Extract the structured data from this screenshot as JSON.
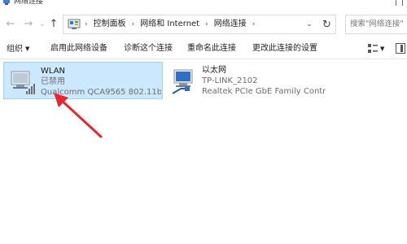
{
  "window": {
    "title": "网络连接"
  },
  "nav": {
    "back_icon": "←",
    "forward_icon": "→",
    "recent_icon": "⌄",
    "up_icon": "↑"
  },
  "address": {
    "crumbs": [
      "控制面板",
      "网络和 Internet",
      "网络连接"
    ],
    "dropdown_icon": "⌄",
    "refresh_icon": "↻"
  },
  "search": {
    "placeholder": "搜索\"网络连接\""
  },
  "commands": {
    "organize": "组织",
    "enable": "启用此网络设备",
    "diagnose": "诊断这个连接",
    "rename": "重命名此连接",
    "change_settings": "更改此连接的设置"
  },
  "connections": [
    {
      "name": "WLAN",
      "status": "已禁用",
      "device": "Qualcomm QCA9565 802.11b/...",
      "icon": "wifi-adapter-icon",
      "selected": true
    },
    {
      "name": "以太网",
      "status": "TP-LINK_2102",
      "device": "Realtek PCIe GbE Family Contr...",
      "icon": "ethernet-adapter-icon",
      "selected": false
    }
  ],
  "colors": {
    "selection_bg": "#cce8ff",
    "selection_border": "#99d1ff",
    "annotation_arrow": "#e8262e"
  }
}
